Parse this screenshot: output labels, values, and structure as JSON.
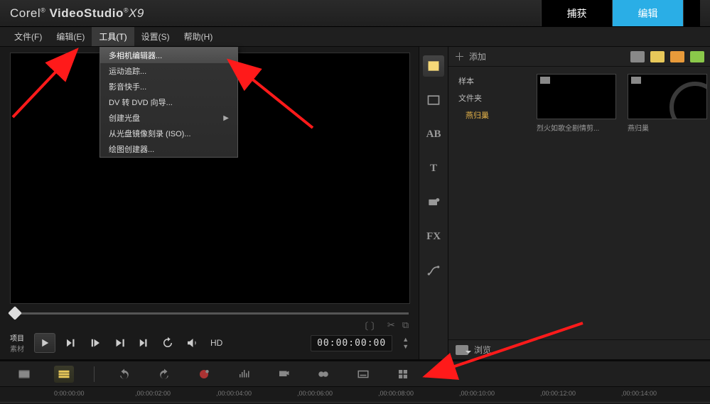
{
  "title": {
    "brand": "Corel",
    "product": "VideoStudio",
    "version": "X9"
  },
  "mode_tabs": {
    "capture": "捕获",
    "edit": "编辑"
  },
  "menubar": {
    "file": "文件(F)",
    "edit": "编辑(E)",
    "tools": "工具(T)",
    "settings": "设置(S)",
    "help": "帮助(H)"
  },
  "tools_menu": {
    "multicam": "多相机编辑器...",
    "motion": "运动追踪...",
    "quickmovie": "影音快手...",
    "dvdvd": "DV 转 DVD 向导...",
    "createdisc": "创建光盘",
    "iso": "从光盘镜像刻录 (ISO)...",
    "painting": "绘图创建器..."
  },
  "library": {
    "add": "添加",
    "sample": "样本",
    "folder": "文件夹",
    "selected_folder": "燕归巢",
    "browse": "浏览",
    "thumbs": [
      {
        "label": "烈火如歌全剧情剪..."
      },
      {
        "label": "燕归巢"
      }
    ]
  },
  "sidebar": {
    "ab": "AB",
    "t": "T",
    "fx": "FX"
  },
  "player": {
    "project": "项目",
    "clip": "素材",
    "hd": "HD",
    "timecode": "00:00:00:00"
  },
  "ruler": {
    "t0": "0:00:00:00",
    "t2": ",00:00:02:00",
    "t4": ",00:00:04:00",
    "t6": ",00:00:06:00",
    "t8": ",00:00:08:00",
    "t10": ",00:00:10:00",
    "t12": ",00:00:12:00",
    "t14": ",00:00:14:00"
  }
}
